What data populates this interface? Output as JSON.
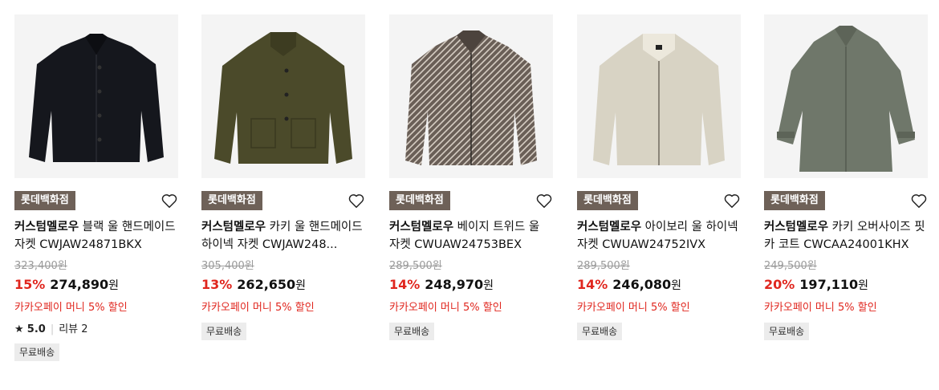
{
  "products": [
    {
      "store": "롯데백화점",
      "brand": "커스텀멜로우",
      "name": "블랙 울 핸드메이드 자켓 CWJAW24871BKX",
      "original_price": "323,400",
      "price_unit": "원",
      "discount": "15%",
      "price": "274,890",
      "promo": "카카오페이 머니 5% 할인",
      "rating": "5.0",
      "reviews": "리뷰 2",
      "shipping": "무료배송",
      "image_color": "#15171d"
    },
    {
      "store": "롯데백화점",
      "brand": "커스텀멜로우",
      "name": "카키 울 핸드메이드 하이넥 자켓 CWJAW248...",
      "original_price": "305,400",
      "price_unit": "원",
      "discount": "13%",
      "price": "262,650",
      "promo": "카카오페이 머니 5% 할인",
      "shipping": "무료배송",
      "image_color": "#4b4a2a"
    },
    {
      "store": "롯데백화점",
      "brand": "커스텀멜로우",
      "name": "베이지 트위드 울 자켓 CWUAW24753BEX",
      "original_price": "289,500",
      "price_unit": "원",
      "discount": "14%",
      "price": "248,970",
      "promo": "카카오페이 머니 5% 할인",
      "shipping": "무료배송",
      "image_color": "#6a5f57"
    },
    {
      "store": "롯데백화점",
      "brand": "커스텀멜로우",
      "name": "아이보리 울 하이넥 자켓 CWUAW24752IVX",
      "original_price": "289,500",
      "price_unit": "원",
      "discount": "14%",
      "price": "246,080",
      "promo": "카카오페이 머니 5% 할인",
      "shipping": "무료배송",
      "image_color": "#d8d3c4"
    },
    {
      "store": "롯데백화점",
      "brand": "커스텀멜로우",
      "name": "카키 오버사이즈 핏 카 코트 CWCAA24001KHX",
      "original_price": "249,500",
      "price_unit": "원",
      "discount": "20%",
      "price": "197,110",
      "promo": "카카오페이 머니 5% 할인",
      "shipping": "무료배송",
      "image_color": "#6f776a"
    }
  ]
}
